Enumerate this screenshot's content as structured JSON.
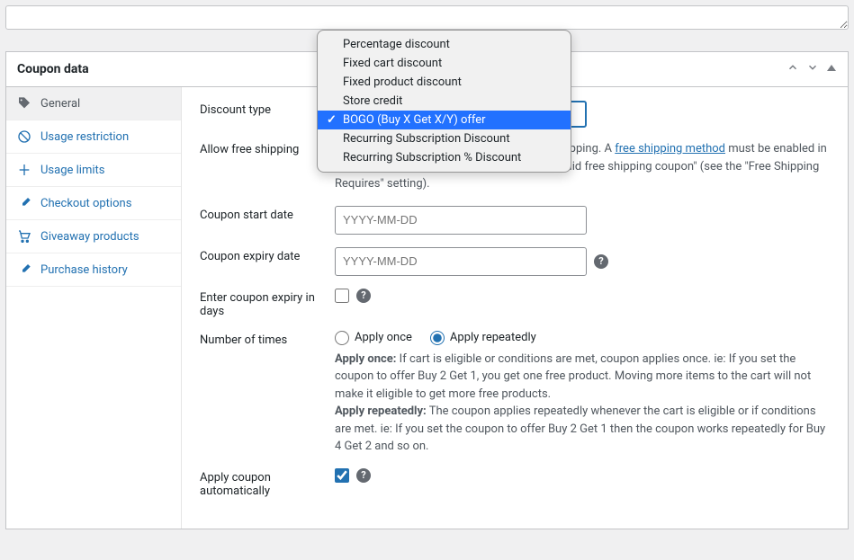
{
  "panel": {
    "title": "Coupon data"
  },
  "tabs": [
    {
      "id": "general",
      "label": "General",
      "active": true
    },
    {
      "id": "usage-restriction",
      "label": "Usage restriction",
      "active": false
    },
    {
      "id": "usage-limits",
      "label": "Usage limits",
      "active": false
    },
    {
      "id": "checkout-options",
      "label": "Checkout options",
      "active": false
    },
    {
      "id": "giveaway-products",
      "label": "Giveaway products",
      "active": false
    },
    {
      "id": "purchase-history",
      "label": "Purchase history",
      "active": false
    }
  ],
  "dropdown": {
    "options": [
      "Percentage discount",
      "Fixed cart discount",
      "Fixed product discount",
      "Store credit",
      "BOGO (Buy X Get X/Y) offer",
      "Recurring Subscription Discount",
      "Recurring Subscription % Discount"
    ],
    "selected": "BOGO (Buy X Get X/Y) offer"
  },
  "form": {
    "discount_type": {
      "label": "Discount type"
    },
    "free_shipping": {
      "label": "Allow free shipping",
      "desc_prefix": "hipping. A ",
      "desc_link": "free shipping method",
      "desc_suffix": " must be enabled in your shipping zone and be set to require \"a valid free shipping coupon\" (see the \"Free Shipping Requires\" setting)."
    },
    "start_date": {
      "label": "Coupon start date",
      "placeholder": "YYYY-MM-DD"
    },
    "expiry_date": {
      "label": "Coupon expiry date",
      "placeholder": "YYYY-MM-DD"
    },
    "expiry_days": {
      "label": "Enter coupon expiry in days"
    },
    "number_times": {
      "label": "Number of times",
      "opt1": "Apply once",
      "opt2": "Apply repeatedly",
      "desc_bold1": "Apply once:",
      "desc_text1": " If cart is eligible or conditions are met, coupon applies once. ie: If you set the coupon to offer Buy 2 Get 1, you get one free product. Moving more items to the cart will not make it eligible to get more free products.",
      "desc_bold2": "Apply repeatedly:",
      "desc_text2": " The coupon applies repeatedly whenever the cart is eligible or if conditions are met. ie: If you set the coupon to offer Buy 2 Get 1 then the coupon works repeatedly for Buy 4 Get 2 and so on."
    },
    "apply_auto": {
      "label": "Apply coupon automatically"
    }
  }
}
